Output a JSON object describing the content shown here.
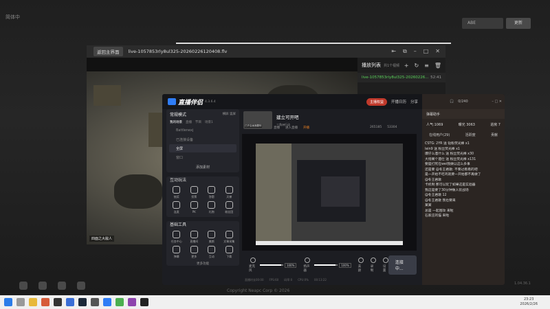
{
  "launcher": {
    "top_label": "简体中",
    "box1": "ABE",
    "box2": "更新"
  },
  "player": {
    "back_label": "返回主界面",
    "file_name": "live-1057853rly8ul325-20260226120408.flv",
    "video_caption": "四面之大敌人",
    "playlist_title": "播放列表",
    "playlist_sub": "共1个视频",
    "playlist_item": "live-1057853rly8ul325-20260226...",
    "playlist_time": "52:41"
  },
  "app": {
    "logo": "直播伴侣",
    "version": "4.3.6.4",
    "vip": "主播权益",
    "top_actions": [
      "开播日历",
      "分享"
    ],
    "mode_title": "常规模式",
    "mode_links": "横屏 竖屏",
    "tabs": [
      "我的场景",
      "直播",
      "节目",
      "场景1"
    ],
    "sources": [
      "Battlenexj",
      "已连接设备",
      "全屏",
      "窗口"
    ],
    "add_source": "添加素材",
    "sec_interactive": "互动玩法",
    "interactive_tools": [
      "抽奖",
      "投票",
      "答题",
      "天梯",
      "连麦",
      "PK",
      "礼物",
      "粉丝团"
    ],
    "sec_basic": "基础工具",
    "basic_tools": [
      "任务中心",
      "直播间",
      "美颜",
      "文章采集",
      "弹幕",
      "更多",
      "互动",
      "下载"
    ],
    "more": "更多功能",
    "room_title": "建立可开吧",
    "room_thumb": "已开启画面翻转",
    "room_sub": "三角洲行动",
    "room_meta": [
      "直播",
      "进入直播"
    ],
    "room_meta_2": "开播",
    "fans_a": "265185",
    "fans_b": "53304",
    "ctl_mic": "麦克风",
    "ctl_speaker": "扬声器",
    "vol_mic": "100%",
    "vol_speaker": "100%",
    "ctl_record": "录制",
    "ctl_beauty": "美颜",
    "ctl_settings": "设置",
    "go_live": "连接中...",
    "status": [
      "直播时长00:00",
      "FPS:60",
      "码率:0",
      "CPU:0%",
      "00:13:22"
    ]
  },
  "chat": {
    "fans": "0/240",
    "header": "弹幕助手",
    "stats_left": "人气:1069",
    "stats_mid": "曝光 3063",
    "stats_right": "进房 7",
    "tabs": [
      "在线用户(29)",
      "活跃度",
      "贡献"
    ],
    "messages": [
      "CSTG: 2YR 送 钻粉荧光棒 x1",
      "lein9 送 粉丝荧光棒 x1",
      "爆仔么酒什么 送 粉丝荧光棒 x30",
      "大炮阁个酒仕 送 粉丝荧光棒 x131",
      "要是打死在wei我做以这么多事",
      "还是要 @冬王君歌: 不要过看看的吧",
      "是一开始不吃鸡就要一开始都不再做了",
      "@冬王君歌 ",
      "卡机制 那可以玩了如果这是实验器",
      "我这是要了30分钟做人装战场",
      "@冬王君歌 12",
      "@冬王君歌 我也要来",
      "某某",
      "总是 一起围攻 来啦",
      "石家庄的猫 来啦"
    ]
  },
  "taskbar": {
    "time": "23:23",
    "date": "2026/2/26"
  },
  "copyright": "Copyright Neapc Corp © 2026",
  "version_text": "1.04.36.1"
}
